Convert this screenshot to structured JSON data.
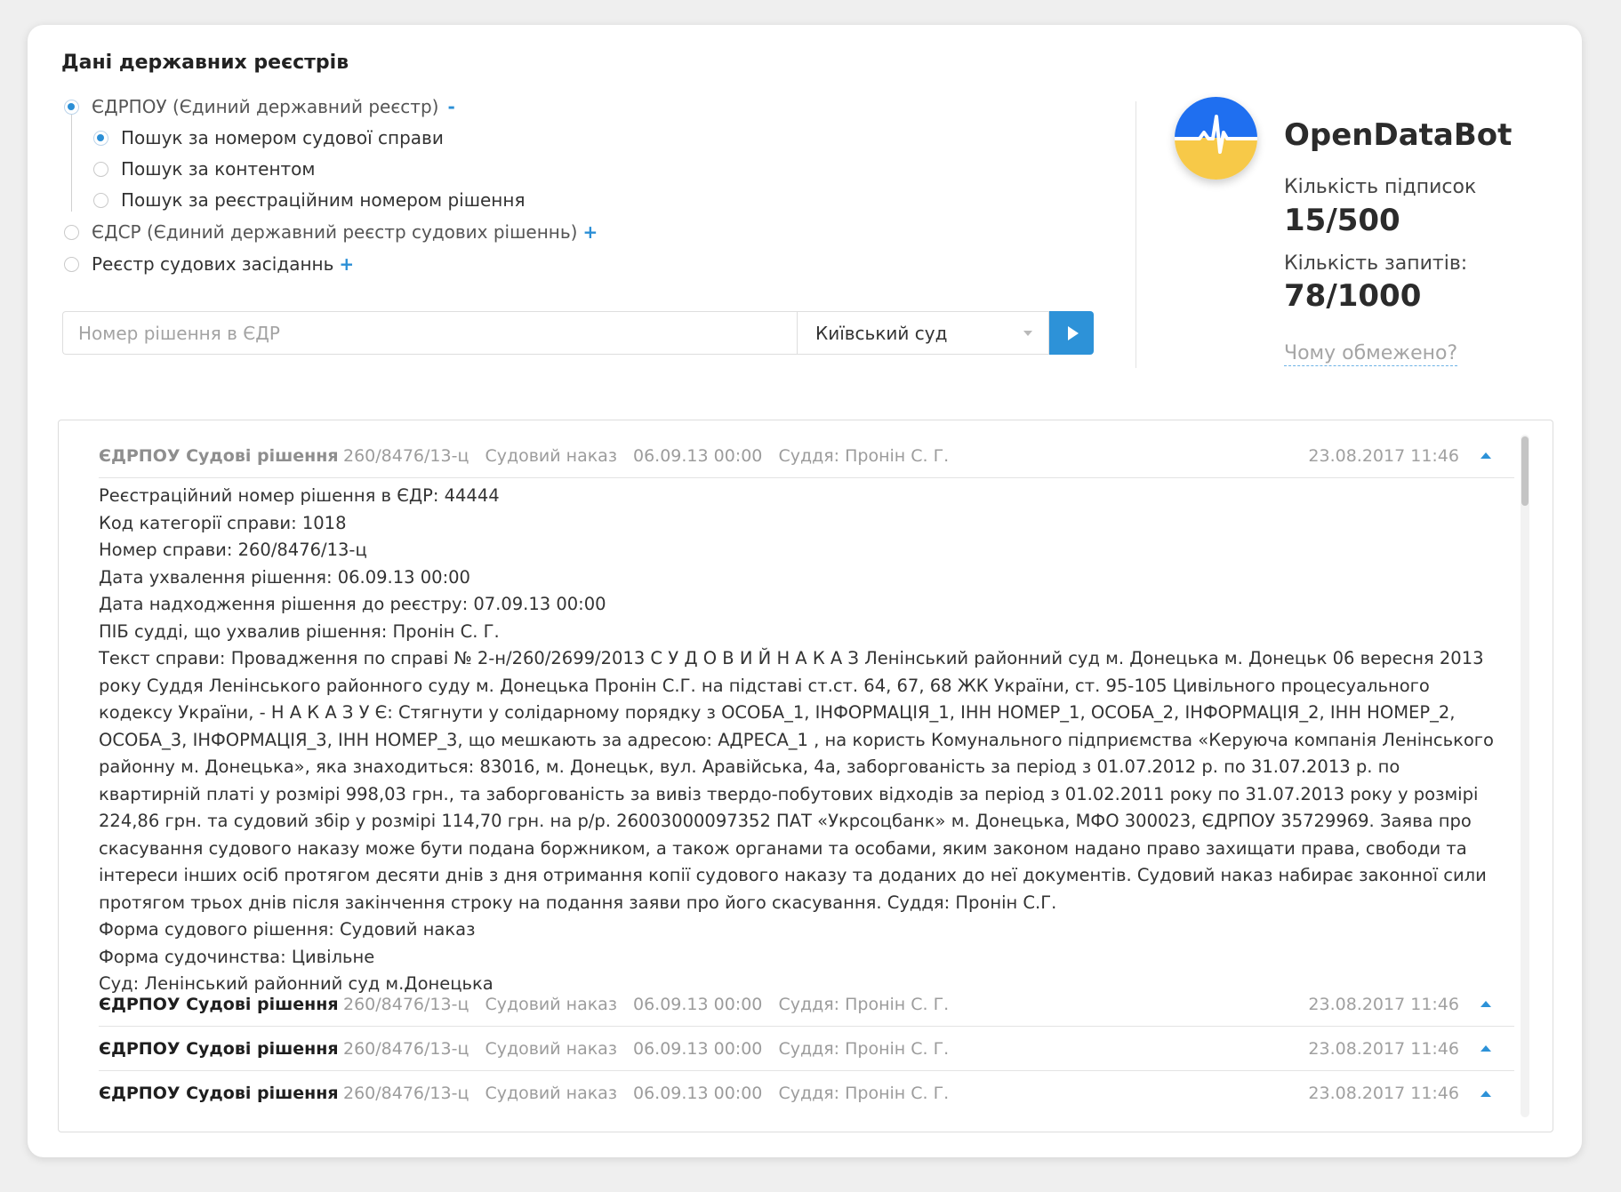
{
  "header": {
    "title": "Дані державних реєстрів"
  },
  "registries": [
    {
      "label": "ЄДРПОУ (Єдиний державний реєстр)",
      "toggle": "-",
      "selected": true
    },
    {
      "label": "Пошук за номером судової справи",
      "selected": true,
      "child": true
    },
    {
      "label": "Пошук за контентом",
      "selected": false,
      "child": true
    },
    {
      "label": "Пошук за реєстраційним номером рішення",
      "selected": false,
      "child": true
    },
    {
      "label": "ЄДСР (Єдиний державний реєстр судових рішеннь)",
      "toggle": "+",
      "selected": false
    },
    {
      "label": "Реєстр судових засіданнь",
      "toggle": "+",
      "selected": false
    }
  ],
  "search": {
    "placeholder": "Номер рішення в ЄДР",
    "value": "",
    "court": "Київський суд",
    "submit_icon": "play-icon"
  },
  "bot": {
    "name": "OpenDataBot",
    "subs_label": "Кількість підписок",
    "subs_value": "15/500",
    "req_label": "Кількість запитів:",
    "req_value": "78/1000",
    "why_link": "Чому обмежено?",
    "logo_colors": {
      "top": "#1f6ff0",
      "bottom": "#f7c948",
      "line": "#ffffff"
    }
  },
  "results": [
    {
      "source": "ЄДРПОУ Судові рішення",
      "case_no": "260/8476/13-ц",
      "type": "Судовий наказ",
      "decided": "06.09.13 00:00",
      "judge": "Суддя: Пронін С. Г.",
      "date": "23.08.2017 11:46"
    },
    {
      "source": "ЄДРПОУ Судові рішення",
      "case_no": "260/8476/13-ц",
      "type": "Судовий наказ",
      "decided": "06.09.13 00:00",
      "judge": "Суддя: Пронін С. Г.",
      "date": "23.08.2017 11:46"
    },
    {
      "source": "ЄДРПОУ Судові рішення",
      "case_no": "260/8476/13-ц",
      "type": "Судовий наказ",
      "decided": "06.09.13 00:00",
      "judge": "Суддя: Пронін С. Г.",
      "date": "23.08.2017 11:46"
    },
    {
      "source": "ЄДРПОУ Судові рішення",
      "case_no": "260/8476/13-ц",
      "type": "Судовий наказ",
      "decided": "06.09.13 00:00",
      "judge": "Суддя: Пронін С. Г.",
      "date": "23.08.2017 11:46"
    }
  ],
  "detail": {
    "reg_no": "Реєстраційний номер рішення в ЄДР: 44444",
    "category": "Код категорії справи: 1018",
    "case_no": "Номер справи: 260/8476/13-ц",
    "adopted": "Дата ухвалення рішення: 06.09.13 00:00",
    "received": "Дата надходження рішення до реєстру: 07.09.13 00:00",
    "judge": "ПІБ судді, що ухвалив рішення: Пронін С. Г.",
    "text": "Текст справи: Провадження по справі № 2-н/260/2699/2013 С У Д О В И Й Н А К А З Ленінський районний суд м. Донецька м. Донецьк 06 вересня 2013 року Суддя Ленінського районного суду м. Донецька Пронін С.Г. на підставі ст.ст. 64, 67, 68 ЖК України, ст. 95-105 Цивільного процесуального кодексу України, - Н А К А З У Є: Стягнути у солідарному порядку з ОСОБА_1, ІНФОРМАЦІЯ_1, ІНН НОМЕР_1, ОСОБА_2, ІНФОРМАЦІЯ_2, ІНН НОМЕР_2, ОСОБА_3, ІНФОРМАЦІЯ_3, ІНН НОМЕР_3, що мешкають за адресою: АДРЕСА_1 , на користь Комунального підприємства «Керуюча компанія Ленінського районну м. Донецька», яка знаходиться: 83016, м. Донецьк, вул. Аравійська, 4а, заборгованість за період з 01.07.2012 р. по 31.07.2013 р. по квартирній платі у розмірі 998,03 грн., та заборгованість за вивіз твердо-побутових відходів за період з 01.02.2011 року по 31.07.2013 року у розмірі 224,86 грн. та судовий збір у розмірі 114,70 грн. на р/р. 26003000097352 ПАТ «Укрсоцбанк» м. Донецька, МФО 300023, ЄДРПОУ 35729969. Заява про скасування судового наказу може бути подана боржником, а також органами та особами, яким законом надано право захищати права, свободи та інтереси інших осіб протягом десяти днів з дня отримання копії судового наказу та доданих до неї документів. Судовий наказ набирає законної сили протягом трьох днів після закінчення строку на подання заяви про його скасування. Суддя: Пронін С.Г.",
    "form": "Форма судового рішення: Судовий наказ",
    "proceeding": "Форма судочинства: Цивільне",
    "court": "Суд: Ленінський районний суд м.Донецька"
  }
}
